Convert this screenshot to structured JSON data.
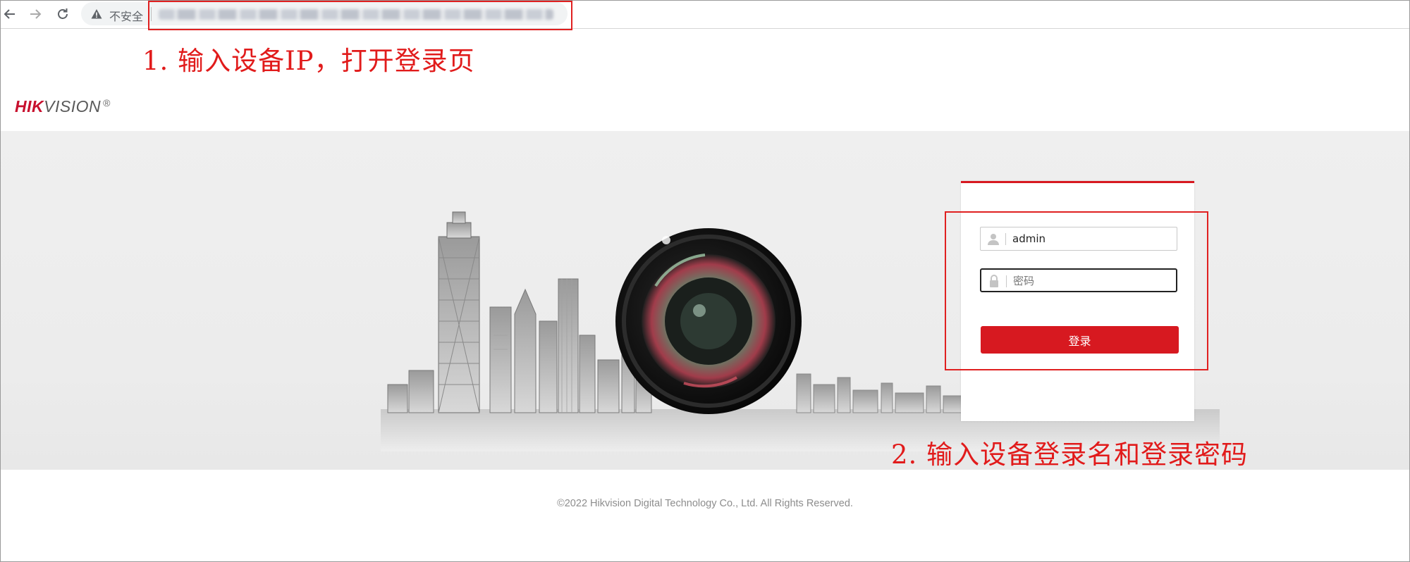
{
  "browser": {
    "security_label": "不安全",
    "back_icon": "back-arrow-icon",
    "forward_icon": "forward-arrow-icon",
    "reload_icon": "reload-icon",
    "warning_icon": "warning-triangle-icon"
  },
  "annotations": {
    "step1": "1. 输入设备IP，打开登录页",
    "step2": "2. 输入设备登录名和登录密码",
    "color": "#e11b1b"
  },
  "header": {
    "logo_hik": "HIK",
    "logo_vision": "VISION",
    "logo_reg": "®"
  },
  "login": {
    "username_value": "admin",
    "password_placeholder": "密码",
    "submit_label": "登录",
    "accent": "#d71920",
    "user_icon": "user-icon",
    "lock_icon": "lock-icon"
  },
  "footer": {
    "copyright": "©2022 Hikvision Digital Technology Co., Ltd. All Rights Reserved."
  }
}
